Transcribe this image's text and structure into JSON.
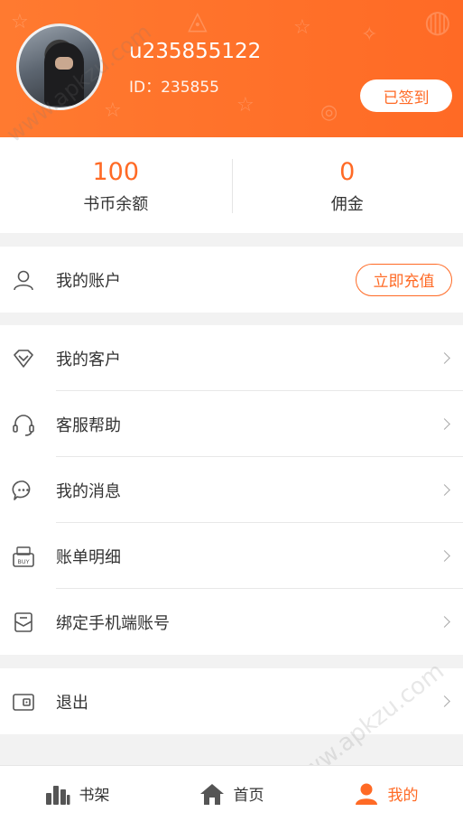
{
  "header": {
    "username": "u235855122",
    "user_id": "ID：235855",
    "signed_label": "已签到"
  },
  "stats": [
    {
      "value": "100",
      "label": "书币余额"
    },
    {
      "value": "0",
      "label": "佣金"
    }
  ],
  "account": {
    "label": "我的账户",
    "recharge_label": "立即充值"
  },
  "menu": [
    {
      "label": "我的客户",
      "icon": "diamond-icon"
    },
    {
      "label": "客服帮助",
      "icon": "headset-icon"
    },
    {
      "label": "我的消息",
      "icon": "message-icon"
    },
    {
      "label": "账单明细",
      "icon": "bill-icon"
    },
    {
      "label": "绑定手机端账号",
      "icon": "bind-phone-icon"
    }
  ],
  "logout": {
    "label": "退出",
    "icon": "wallet-icon"
  },
  "tabs": [
    {
      "label": "书架",
      "icon": "bookshelf-icon"
    },
    {
      "label": "首页",
      "icon": "home-icon"
    },
    {
      "label": "我的",
      "icon": "user-icon",
      "active": true
    }
  ],
  "watermark": "www.apkzu.com",
  "colors": {
    "accent": "#ff6a25",
    "background": "#f2f2f2"
  }
}
